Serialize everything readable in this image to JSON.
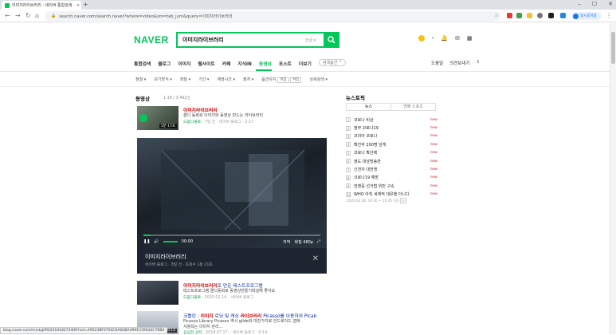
{
  "browser": {
    "tab_title": "이미지라이브러리 : 네이버 통합검색",
    "url": "search.naver.com/search.naver?where=video&sm=tab_jum&query=이미지라이브러리",
    "profile_label": "일시중지됨"
  },
  "header": {
    "logo": "NAVER",
    "query": "이미지라이브러리",
    "kbd_hint": "한글 ▾"
  },
  "tabs": {
    "items": [
      "통합검색",
      "블로그",
      "이미지",
      "웹사이트",
      "카페",
      "지식iN",
      "동영상",
      "포스트",
      "더보기"
    ],
    "active": "동영상",
    "options_label": "검색옵션 ^"
  },
  "extra_links": [
    "도움말",
    "의견보내기"
  ],
  "filters": [
    "정렬",
    "보기방식",
    "화질",
    "기간",
    "재생시간",
    "출처",
    "옵션유지",
    "상세검색"
  ],
  "filter_chips": [
    "꺼짐",
    "켜짐"
  ],
  "section": {
    "title": "동영상",
    "count": "1-16 / 3,492건"
  },
  "results": [
    {
      "title_hl": "이미지라이브러리",
      "title_rest": "",
      "desc": "클디 동화로 이미지와 동영상 만드는 라이브러리",
      "source": "드림디블로",
      "date": "7일 전",
      "channel": "네이버 블로그",
      "extra": "2:17",
      "duration": "1분 17초"
    },
    {
      "title_hl": "이미지라이브러리",
      "title_rest": "로 만든 테스트프로그램",
      "desc": "테스트프로그램 클디동화로 동영상만들기테실해 좋아요",
      "source": "드림디블로",
      "date": "2020.02.14.",
      "channel": "네이버 블로그",
      "extra": "",
      "duration": ""
    },
    {
      "title_pre": "코틀린 : ",
      "title_hl": "이미지",
      "title_mid": " 로딩 및 캐싱 ",
      "title_hl2": "라이브러리",
      "title_rest": " Picasso를 이용하여 Picab",
      "desc": "Picasso Library Picasso 역시 glide와 마찬가지로 안드로이드 앱에",
      "desc2": "사용되는 이미지 관리...",
      "source": "심심한 상자",
      "date": "2018.07.17.",
      "channel": "네이버 블로그",
      "extra": "0:14",
      "duration": "0:14"
    }
  ],
  "player": {
    "title": "이미지라이브러리",
    "meta": "네이버 블로그 · 3일 전 · 조회수 1분 21초",
    "time": "00:00",
    "quality": "화질 480p",
    "caption": "자막",
    "progress": 0.04
  },
  "news": {
    "title": "뉴스토픽",
    "tabs": [
      "뉴스",
      "연예 스포츠"
    ],
    "items": [
      "코로나 비상",
      "정부 코로나19",
      "코리아 코로나",
      "확진자 200명 넘게",
      "코로나 확산에",
      "정도 대남방송만",
      "신천지 대전쟁",
      "코로나19 예방",
      "전쟁중 선거법 위반 구속",
      "WHO 아직 세계적 대유행 아니다"
    ],
    "new_label": "new",
    "footer": "2020.02.28. 10:30 ~ 10:35 기준"
  },
  "status_url": "blog.naver.com/minkgi99/221818273409?vid=A95238F0704C0A6D8A3991539634C7BB0",
  "colors": {
    "brand": "#03c75a",
    "link": "#0a2aa8",
    "highlight": "#cc0000"
  }
}
